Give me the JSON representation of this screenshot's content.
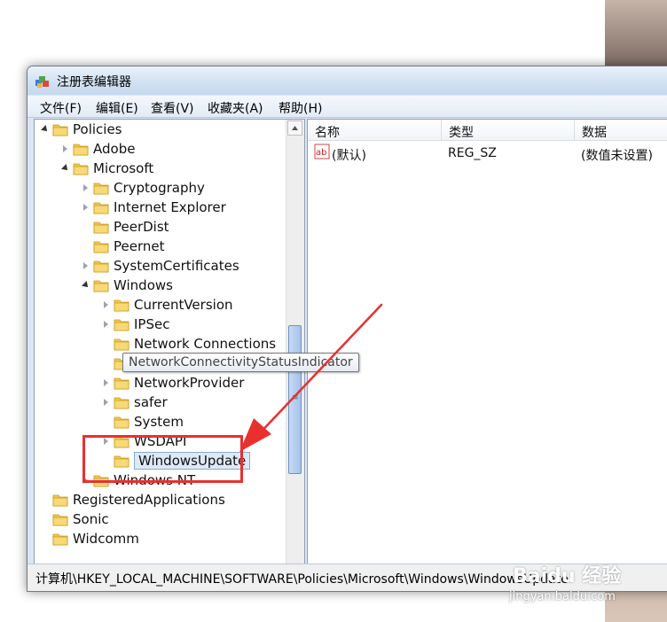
{
  "window": {
    "title": "注册表编辑器"
  },
  "menu": [
    "文件(F)",
    "编辑(E)",
    "查看(V)",
    "收藏夹(A)",
    "帮助(H)"
  ],
  "tree": [
    {
      "label": "Policies",
      "level": 0,
      "state": "expanded"
    },
    {
      "label": "Adobe",
      "level": 1,
      "state": "collapsed"
    },
    {
      "label": "Microsoft",
      "level": 1,
      "state": "expanded"
    },
    {
      "label": "Cryptography",
      "level": 2,
      "state": "collapsed"
    },
    {
      "label": "Internet Explorer",
      "level": 2,
      "state": "collapsed"
    },
    {
      "label": "PeerDist",
      "level": 2,
      "state": "none"
    },
    {
      "label": "Peernet",
      "level": 2,
      "state": "none"
    },
    {
      "label": "SystemCertificates",
      "level": 2,
      "state": "collapsed"
    },
    {
      "label": "Windows",
      "level": 2,
      "state": "expanded"
    },
    {
      "label": "CurrentVersion",
      "level": 3,
      "state": "collapsed"
    },
    {
      "label": "IPSec",
      "level": 3,
      "state": "collapsed"
    },
    {
      "label": "Network Connections",
      "level": 3,
      "state": "none"
    },
    {
      "label": "NetworkConnectivityStatusIndicator",
      "level": 3,
      "state": "none"
    },
    {
      "label": "NetworkProvider",
      "level": 3,
      "state": "collapsed"
    },
    {
      "label": "safer",
      "level": 3,
      "state": "collapsed"
    },
    {
      "label": "System",
      "level": 3,
      "state": "none"
    },
    {
      "label": "WSDAPI",
      "level": 3,
      "state": "collapsed"
    },
    {
      "label": "WindowsUpdate",
      "level": 3,
      "state": "none",
      "selected": true
    },
    {
      "label": "Windows NT",
      "level": 2,
      "state": "collapsed"
    },
    {
      "label": "RegisteredApplications",
      "level": 0,
      "state": "none"
    },
    {
      "label": "Sonic",
      "level": 0,
      "state": "none"
    },
    {
      "label": "Widcomm",
      "level": 0,
      "state": "none"
    }
  ],
  "tooltip": "NetworkConnectivityStatusIndicator",
  "list": {
    "columns": [
      "名称",
      "类型",
      "数据"
    ],
    "rows": [
      {
        "name": "(默认)",
        "type": "REG_SZ",
        "data": "(数值未设置)"
      }
    ]
  },
  "status": "计算机\\HKEY_LOCAL_MACHINE\\SOFTWARE\\Policies\\Microsoft\\Windows\\WindowsUpdate",
  "watermark": {
    "logo": "Baidu 经验",
    "url": "jingyan.baidu.com"
  },
  "colors": {
    "annotation": "#ea2f2f",
    "folder": "#f2c94c",
    "selection": "#dde9f7"
  }
}
